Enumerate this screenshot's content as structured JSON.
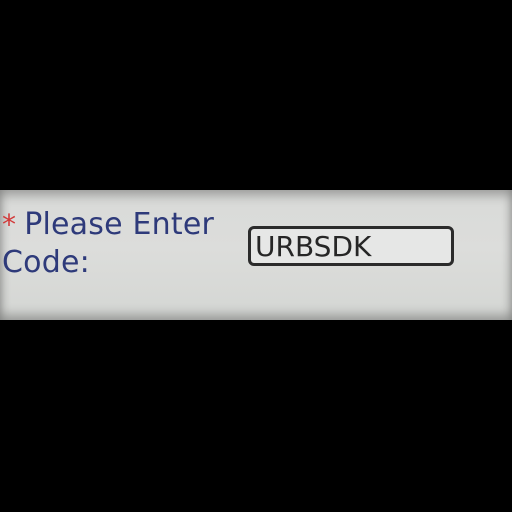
{
  "form": {
    "required_marker": "*",
    "label_line1": "Please Enter",
    "label_line2": "Code:",
    "code_value": "URBSDK"
  }
}
